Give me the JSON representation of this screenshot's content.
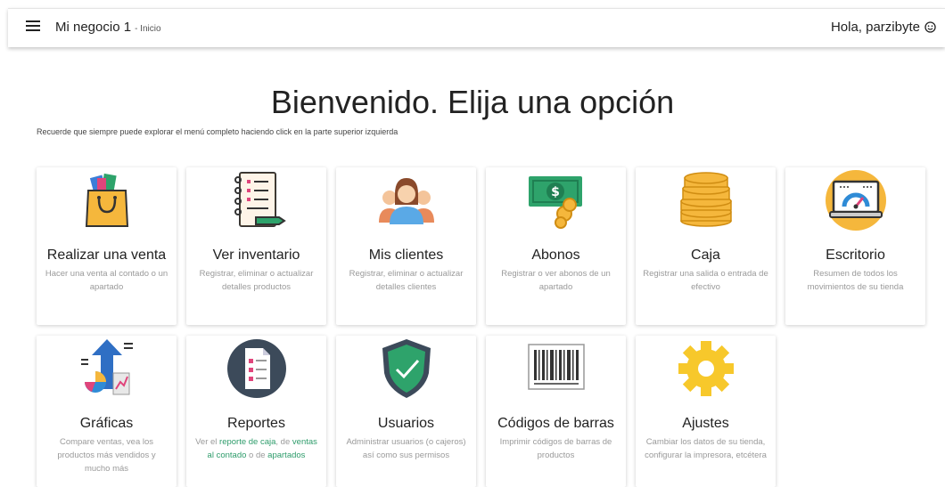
{
  "header": {
    "business": "Mi negocio 1",
    "section": "- Inicio",
    "greeting": "Hola, parzibyte"
  },
  "main": {
    "title": "Bienvenido. Elija una opción",
    "hint": "Recuerde que siempre puede explorar el menú completo haciendo click en la parte superior izquierda"
  },
  "cards": [
    {
      "title": "Realizar una venta",
      "desc": "Hacer una venta al contado o un apartado",
      "icon": "shopping-bag-icon"
    },
    {
      "title": "Ver inventario",
      "desc": "Registrar, eliminar o actualizar detalles productos",
      "icon": "notebook-icon"
    },
    {
      "title": "Mis clientes",
      "desc": "Registrar, eliminar o actualizar detalles clientes",
      "icon": "people-icon"
    },
    {
      "title": "Abonos",
      "desc": "Registrar o ver abonos de un apartado",
      "icon": "money-icon"
    },
    {
      "title": "Caja",
      "desc": "Registrar una salida o entrada de efectivo",
      "icon": "coins-icon"
    },
    {
      "title": "Escritorio",
      "desc": "Resumen de todos los movimientos de su tienda",
      "icon": "dashboard-icon"
    },
    {
      "title": "Gráficas",
      "desc": "Compare ventas, vea los productos más vendidos y mucho más",
      "icon": "charts-icon"
    },
    {
      "title": "Reportes",
      "icon": "report-icon",
      "desc_parts": {
        "p1": "Ver el ",
        "l1": "reporte de caja",
        "p2": ", de ",
        "l2": "ventas al contado",
        "p3": " o de ",
        "l3": "apartados"
      }
    },
    {
      "title": "Usuarios",
      "desc": "Administrar usuarios (o cajeros) así como sus permisos",
      "icon": "shield-icon"
    },
    {
      "title": "Códigos de barras",
      "desc": "Imprimir códigos de barras de productos",
      "icon": "barcode-icon"
    },
    {
      "title": "Ajustes",
      "desc": "Cambiar los datos de su tienda, configurar la impresora, etcétera",
      "icon": "gear-icon"
    }
  ]
}
